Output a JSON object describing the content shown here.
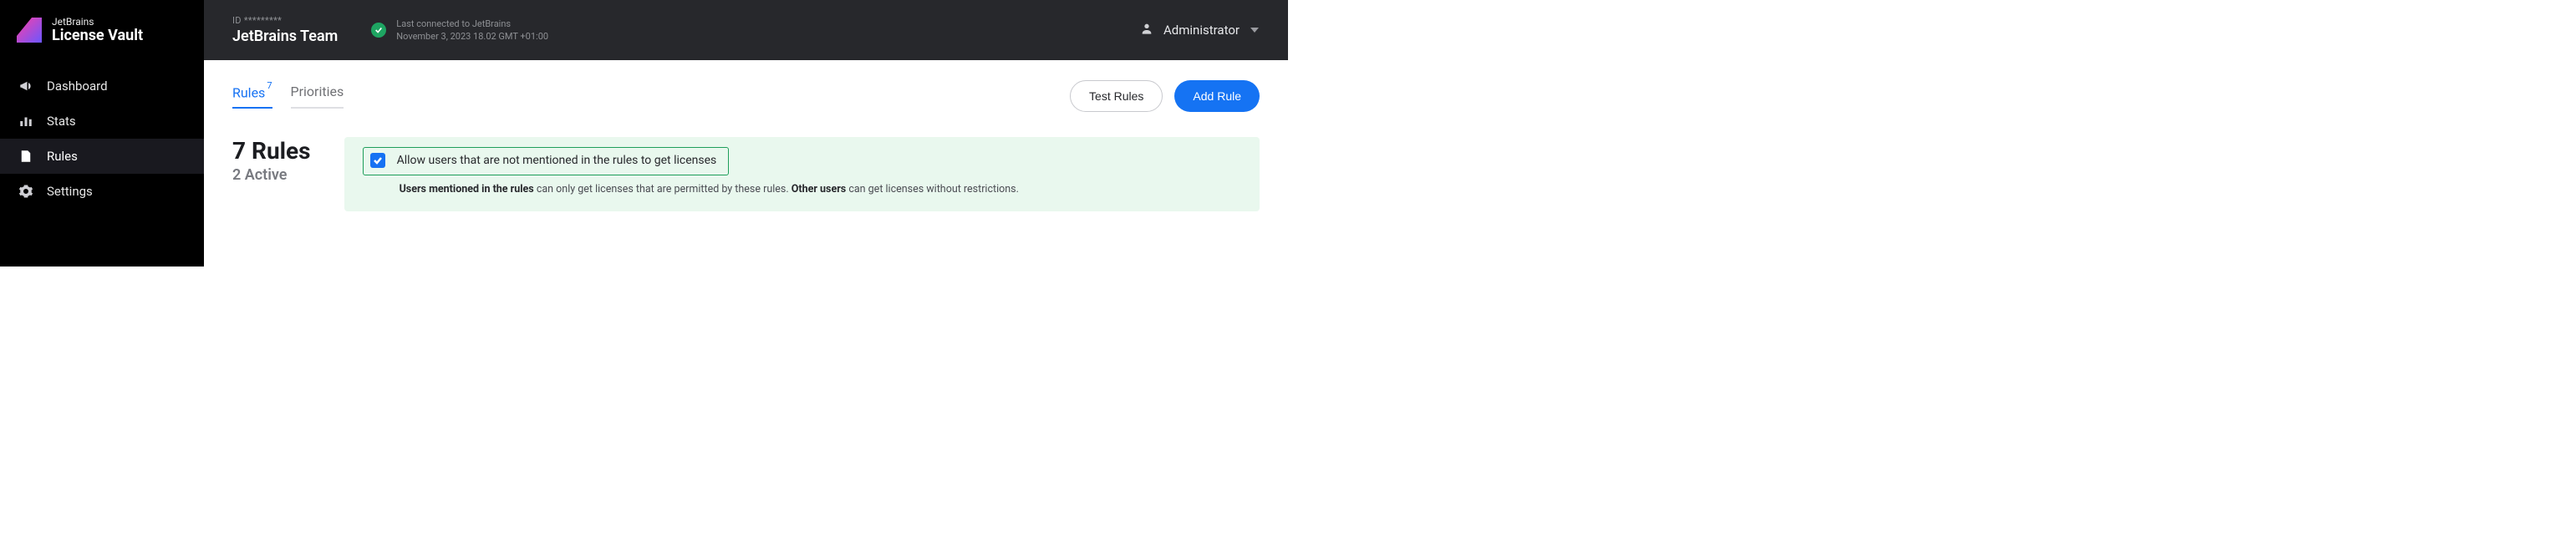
{
  "app": {
    "brand": "JetBrains",
    "product": "License Vault"
  },
  "sidebar": {
    "items": [
      {
        "label": "Dashboard"
      },
      {
        "label": "Stats"
      },
      {
        "label": "Rules"
      },
      {
        "label": "Settings"
      }
    ]
  },
  "header": {
    "id_label": "ID",
    "id_value": "*********",
    "team_name": "JetBrains Team",
    "status_line1": "Last connected to JetBrains",
    "status_line2": "November 3, 2023 18.02 GMT +01:00",
    "user_name": "Administrator"
  },
  "content": {
    "tabs": {
      "rules": {
        "label": "Rules",
        "count": "7"
      },
      "priorities": {
        "label": "Priorities"
      }
    },
    "actions": {
      "test_rules": "Test Rules",
      "add_rule": "Add Rule"
    },
    "heading": {
      "title": "7 Rules",
      "subtitle": "2 Active"
    },
    "notice": {
      "checkbox_label": "Allow users that are not mentioned in the rules to get licenses",
      "desc_bold1": "Users mentioned in the rules",
      "desc_mid": " can only get licenses that are permitted by these rules. ",
      "desc_bold2": "Other users",
      "desc_end": " can get licenses without restrictions."
    }
  }
}
